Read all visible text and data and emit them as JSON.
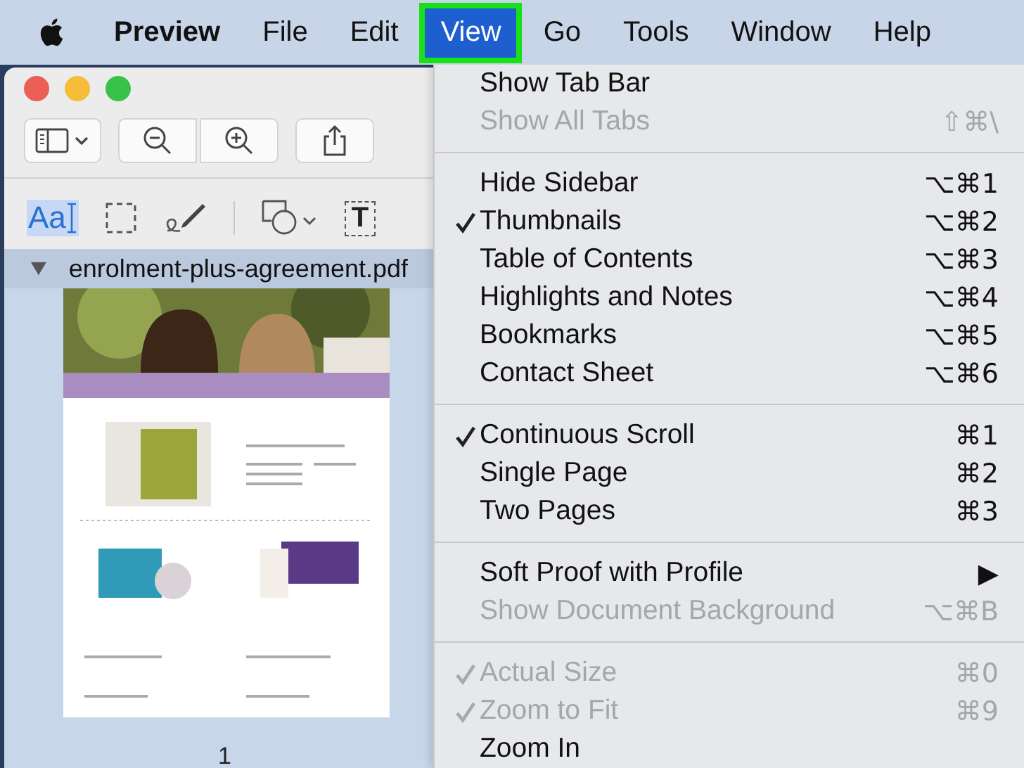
{
  "menu_bar": {
    "items": [
      {
        "label": "Preview",
        "bold": true,
        "selected": false
      },
      {
        "label": "File",
        "bold": false,
        "selected": false
      },
      {
        "label": "Edit",
        "bold": false,
        "selected": false
      },
      {
        "label": "View",
        "bold": false,
        "selected": true
      },
      {
        "label": "Go",
        "bold": false,
        "selected": false
      },
      {
        "label": "Tools",
        "bold": false,
        "selected": false
      },
      {
        "label": "Window",
        "bold": false,
        "selected": false
      },
      {
        "label": "Help",
        "bold": false,
        "selected": false
      }
    ]
  },
  "window": {
    "toolbar": [
      {
        "kind": "sidebar"
      },
      {
        "kind": "zoom-out"
      },
      {
        "kind": "zoom-in"
      },
      {
        "kind": "share"
      }
    ],
    "markup_tools": [
      {
        "kind": "text-select",
        "label": "Aa",
        "selected": true
      },
      {
        "kind": "rect-select",
        "selected": false
      },
      {
        "kind": "sign",
        "selected": false
      },
      {
        "kind": "shapes",
        "selected": false
      },
      {
        "kind": "text-box",
        "label": "T",
        "selected": false
      }
    ],
    "sidebar": {
      "file": "enrolment-plus-agreement.pdf",
      "expanded": true,
      "thumbnails": [
        {
          "kind": "picture",
          "page": "1"
        }
      ]
    }
  },
  "view_menu": [
    {
      "kind": "item",
      "label": "Show Tab Bar",
      "checked": false,
      "disabled": false
    },
    {
      "kind": "item",
      "label": "Show All Tabs",
      "shortcut": "⇧⌘\\",
      "checked": false,
      "disabled": true
    },
    {
      "kind": "separator"
    },
    {
      "kind": "item",
      "label": "Hide Sidebar",
      "shortcut": "⌥⌘1",
      "checked": false,
      "disabled": false
    },
    {
      "kind": "item",
      "label": "Thumbnails",
      "shortcut": "⌥⌘2",
      "checked": true,
      "disabled": false
    },
    {
      "kind": "item",
      "label": "Table of Contents",
      "shortcut": "⌥⌘3",
      "checked": false,
      "disabled": false
    },
    {
      "kind": "item",
      "label": "Highlights and Notes",
      "shortcut": "⌥⌘4",
      "checked": false,
      "disabled": false
    },
    {
      "kind": "item",
      "label": "Bookmarks",
      "shortcut": "⌥⌘5",
      "checked": false,
      "disabled": false
    },
    {
      "kind": "item",
      "label": "Contact Sheet",
      "shortcut": "⌥⌘6",
      "checked": false,
      "disabled": false
    },
    {
      "kind": "separator"
    },
    {
      "kind": "item",
      "label": "Continuous Scroll",
      "shortcut": "⌘1",
      "checked": true,
      "disabled": false
    },
    {
      "kind": "item",
      "label": "Single Page",
      "shortcut": "⌘2",
      "checked": false,
      "disabled": false
    },
    {
      "kind": "item",
      "label": "Two Pages",
      "shortcut": "⌘3",
      "checked": false,
      "disabled": false
    },
    {
      "kind": "separator"
    },
    {
      "kind": "item",
      "label": "Soft Proof with Profile",
      "shortcut": "▶",
      "checked": false,
      "disabled": false
    },
    {
      "kind": "item",
      "label": "Show Document Background",
      "shortcut": "⌥⌘B",
      "checked": false,
      "disabled": true
    },
    {
      "kind": "separator"
    },
    {
      "kind": "item",
      "label": "Actual Size",
      "shortcut": "⌘0",
      "checked": true,
      "disabled": true
    },
    {
      "kind": "item",
      "label": "Zoom to Fit",
      "shortcut": "⌘9",
      "checked": true,
      "disabled": true
    },
    {
      "kind": "item",
      "label": "Zoom In",
      "checked": false,
      "disabled": false
    }
  ]
}
